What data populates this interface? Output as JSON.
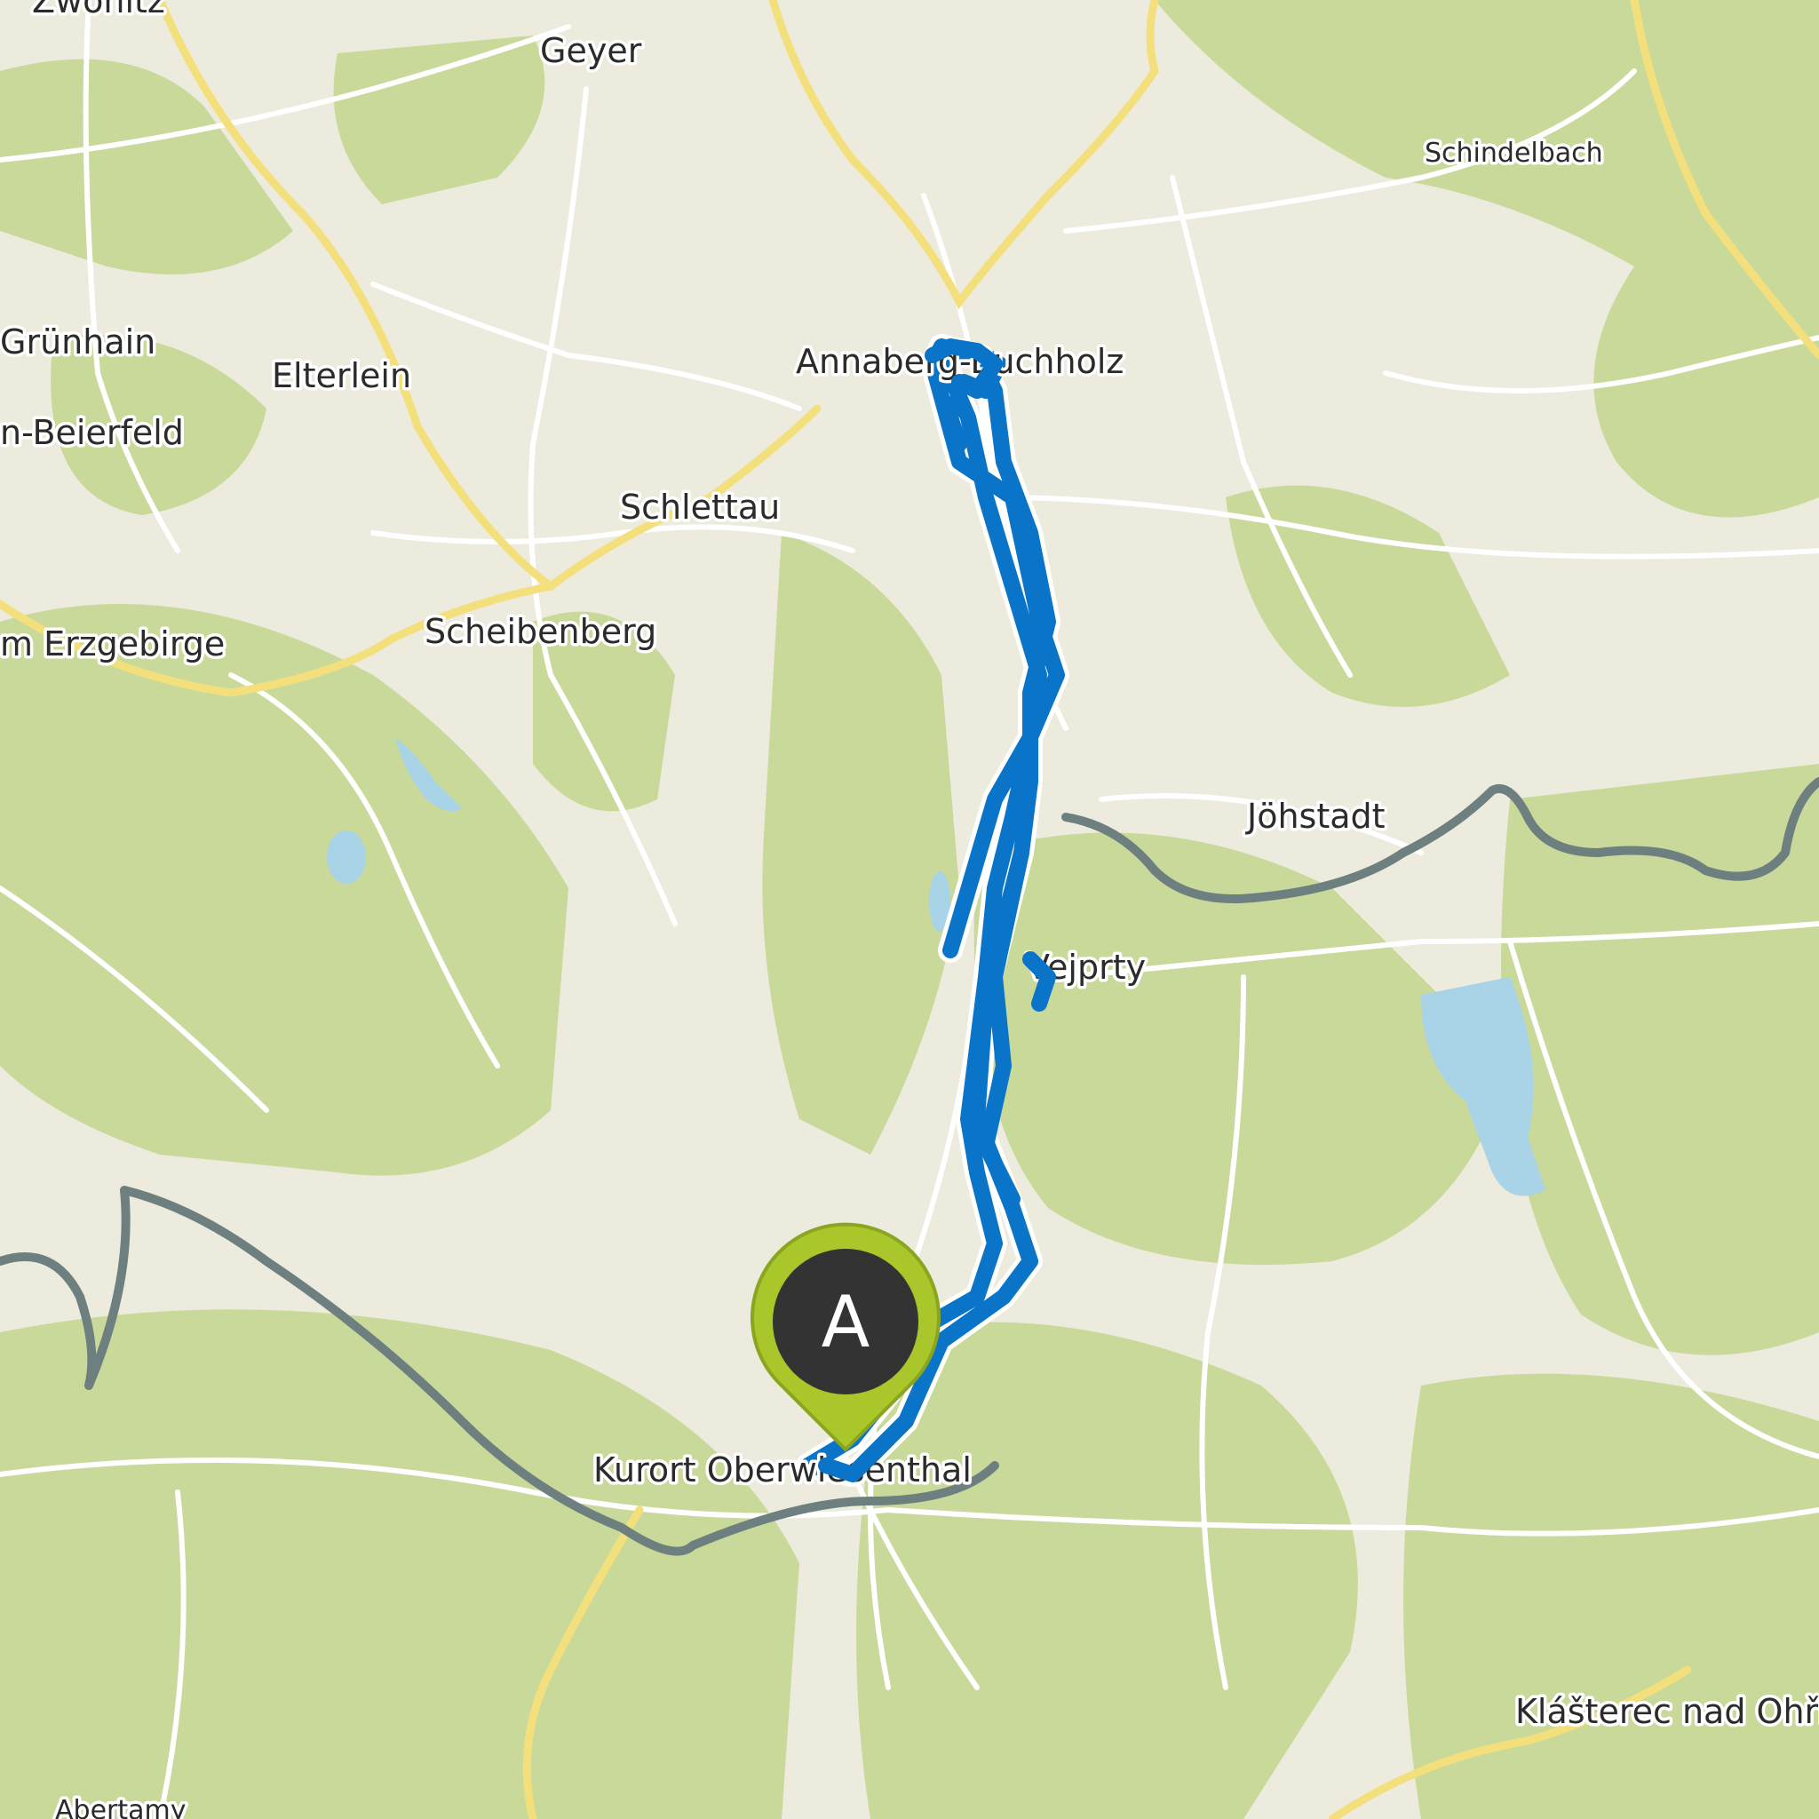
{
  "map": {
    "type": "topographic route map",
    "colors": {
      "forest": "#c9d99a",
      "open_land": "#ecebdd",
      "road_minor": "#ffffff",
      "road_major": "#f5e58a",
      "border": "#6e7f7f",
      "water": "#a9d3e6",
      "route": "#0a74c9",
      "marker_fill": "#a9c62a",
      "marker_inner": "#333333"
    },
    "labels": [
      {
        "id": "zwonitz",
        "text": "Zwönitz"
      },
      {
        "id": "geyer",
        "text": "Geyer"
      },
      {
        "id": "schindelbach",
        "text": "Schindelbach"
      },
      {
        "id": "grunhain",
        "text": "Grünhain"
      },
      {
        "id": "elterlein",
        "text": "Elterlein"
      },
      {
        "id": "annaberg",
        "text": "Annaberg-Buchholz"
      },
      {
        "id": "beierfeld",
        "text": "n-Beierfeld"
      },
      {
        "id": "schlettau",
        "text": "Schlettau"
      },
      {
        "id": "scheibenberg",
        "text": "Scheibenberg"
      },
      {
        "id": "erzgebirge",
        "text": "m Erzgebirge"
      },
      {
        "id": "johstadt",
        "text": "Jöhstadt"
      },
      {
        "id": "vejprty",
        "text": "Vejprty"
      },
      {
        "id": "oberwiesenthal",
        "text": "Kurort Oberwiesenthal"
      },
      {
        "id": "klasterec",
        "text": "Klášterec nad Ohří"
      },
      {
        "id": "abertamy",
        "text": "Abertamy"
      }
    ],
    "start_marker": {
      "letter": "A",
      "icon": "start-pin-icon"
    }
  }
}
